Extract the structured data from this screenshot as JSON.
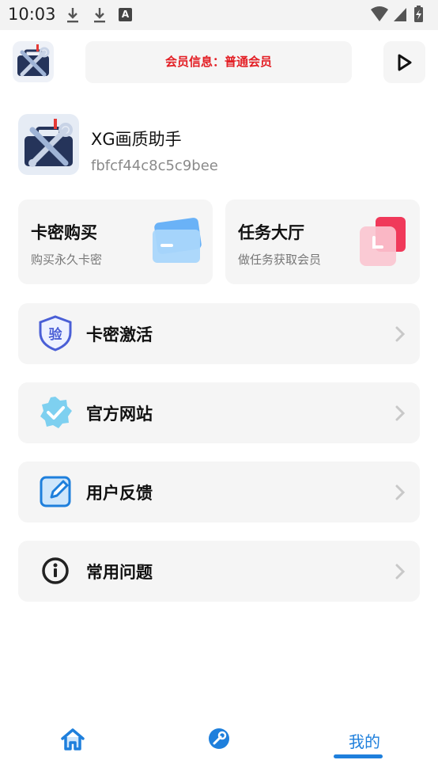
{
  "status_bar": {
    "time": "10:03",
    "icons": [
      "download-icon",
      "download-icon",
      "a-letter-icon",
      "wifi-icon",
      "signal-icon",
      "battery-charging-icon"
    ]
  },
  "header": {
    "member_info": "会员信息：普通会员",
    "play_icon": "play-icon"
  },
  "profile": {
    "app_name": "XG画质助手",
    "device_id": "fbfcf44c8c5c9bee"
  },
  "cards": [
    {
      "title": "卡密购买",
      "subtitle": "购买永久卡密",
      "icon": "card-icon"
    },
    {
      "title": "任务大厅",
      "subtitle": "做任务获取会员",
      "icon": "task-icon"
    }
  ],
  "menu": [
    {
      "label": "卡密激活",
      "icon": "verify-shield-icon",
      "icon_text": "验"
    },
    {
      "label": "官方网站",
      "icon": "verified-badge-icon"
    },
    {
      "label": "用户反馈",
      "icon": "edit-icon"
    },
    {
      "label": "常用问题",
      "icon": "info-icon"
    }
  ],
  "bottom_nav": {
    "items": [
      {
        "icon": "home-icon"
      },
      {
        "icon": "wrench-icon"
      },
      {
        "label": "我的"
      }
    ],
    "active_color": "#1e7fdc"
  },
  "colors": {
    "accent": "#1e7fdc",
    "member_text": "#e31e24",
    "card_bg": "#f5f5f5"
  }
}
